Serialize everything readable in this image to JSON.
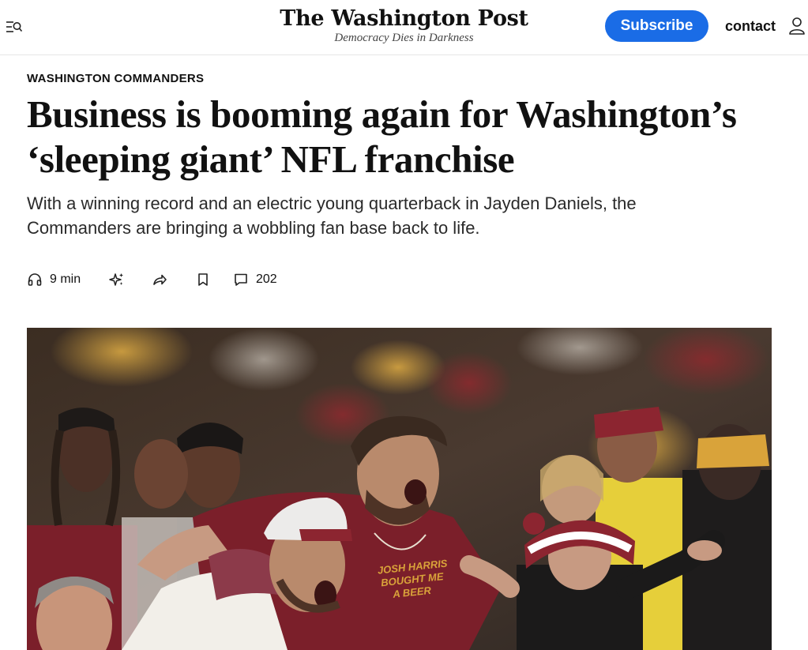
{
  "header": {
    "logo_text": "The Washington Post",
    "tagline": "Democracy Dies in Darkness",
    "subscribe_label": "Subscribe",
    "contact_label": "contact",
    "menu_icon": "menu-search-icon",
    "account_icon": "user-icon"
  },
  "article": {
    "kicker": "WASHINGTON COMMANDERS",
    "headline": "Business is booming again for Washington’s ‘sleeping giant’ NFL franchise",
    "dek": "With a winning record and an electric young quarterback in Jayden Daniels, the Commanders are bringing a wobbling fan base back to life.",
    "actions": {
      "listen_time": "9 min",
      "listen_icon": "headphones-icon",
      "ai_icon": "sparkle-icon",
      "share_icon": "share-arrow-icon",
      "save_icon": "bookmark-icon",
      "comment_icon": "comment-icon",
      "comment_count": "202"
    }
  },
  "photo": {
    "shirt_text": [
      "JOSH HARRIS",
      "BOUGHT ME",
      "A BEER"
    ]
  },
  "colors": {
    "accent": "#1a6ce6",
    "burgundy": "#7a1f2b",
    "gold": "#e2a834"
  }
}
